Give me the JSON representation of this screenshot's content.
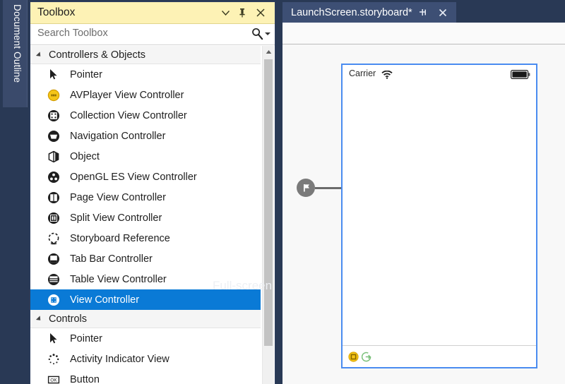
{
  "left_strip": {
    "tab_label": "Document Outline"
  },
  "toolbox": {
    "title": "Toolbox",
    "header_buttons": [
      {
        "name": "dropdown-icon",
        "glyph": "▼"
      },
      {
        "name": "pin-icon",
        "glyph": "∓"
      },
      {
        "name": "close-icon",
        "glyph": "✕"
      }
    ],
    "search": {
      "placeholder": "Search Toolbox",
      "value": "",
      "icon": "search-icon",
      "caret": "chevron-down-icon"
    },
    "groups": [
      {
        "name": "Controllers & Objects",
        "expanded": true,
        "items": [
          {
            "label": "Pointer",
            "icon": "pointer-icon",
            "selected": false
          },
          {
            "label": "AVPlayer View Controller",
            "icon": "avplayer-icon",
            "selected": false
          },
          {
            "label": "Collection View Controller",
            "icon": "collection-view-icon",
            "selected": false
          },
          {
            "label": "Navigation Controller",
            "icon": "navigation-controller-icon",
            "selected": false
          },
          {
            "label": "Object",
            "icon": "object-icon",
            "selected": false
          },
          {
            "label": "OpenGL ES View Controller",
            "icon": "opengl-es-icon",
            "selected": false
          },
          {
            "label": "Page View Controller",
            "icon": "page-view-icon",
            "selected": false
          },
          {
            "label": "Split View Controller",
            "icon": "split-view-icon",
            "selected": false
          },
          {
            "label": "Storyboard Reference",
            "icon": "storyboard-reference-icon",
            "selected": false
          },
          {
            "label": "Tab Bar Controller",
            "icon": "tab-bar-icon",
            "selected": false
          },
          {
            "label": "Table View Controller",
            "icon": "table-view-icon",
            "selected": false
          },
          {
            "label": "View Controller",
            "icon": "view-controller-icon",
            "selected": true
          }
        ]
      },
      {
        "name": "Controls",
        "expanded": true,
        "items": [
          {
            "label": "Pointer",
            "icon": "pointer-icon",
            "selected": false
          },
          {
            "label": "Activity Indicator View",
            "icon": "activity-indicator-icon",
            "selected": false
          },
          {
            "label": "Button",
            "icon": "button-icon",
            "selected": false
          }
        ]
      }
    ],
    "watermark": "Full-screen Snip"
  },
  "editor": {
    "tab": {
      "title": "LaunchScreen.storyboard*",
      "pin_icon": "pin-icon",
      "close_icon": "close-icon"
    },
    "device": {
      "status_bar": {
        "carrier": "Carrier",
        "wifi_icon": "wifi-icon",
        "battery_icon": "battery-icon"
      },
      "footer_icons": [
        {
          "name": "view-controller-scene-icon"
        },
        {
          "name": "exit-segue-icon"
        }
      ]
    },
    "entry_point": {
      "icon": "flag-icon"
    }
  },
  "colors": {
    "toolbox_header": "#fdf2b5",
    "selection": "#0a7ad6",
    "chrome": "#293955",
    "tab_active": "#3d4f74",
    "device_border": "#4a8cf0",
    "accent_yellow": "#f5c518",
    "accent_green": "#7ac07a"
  }
}
